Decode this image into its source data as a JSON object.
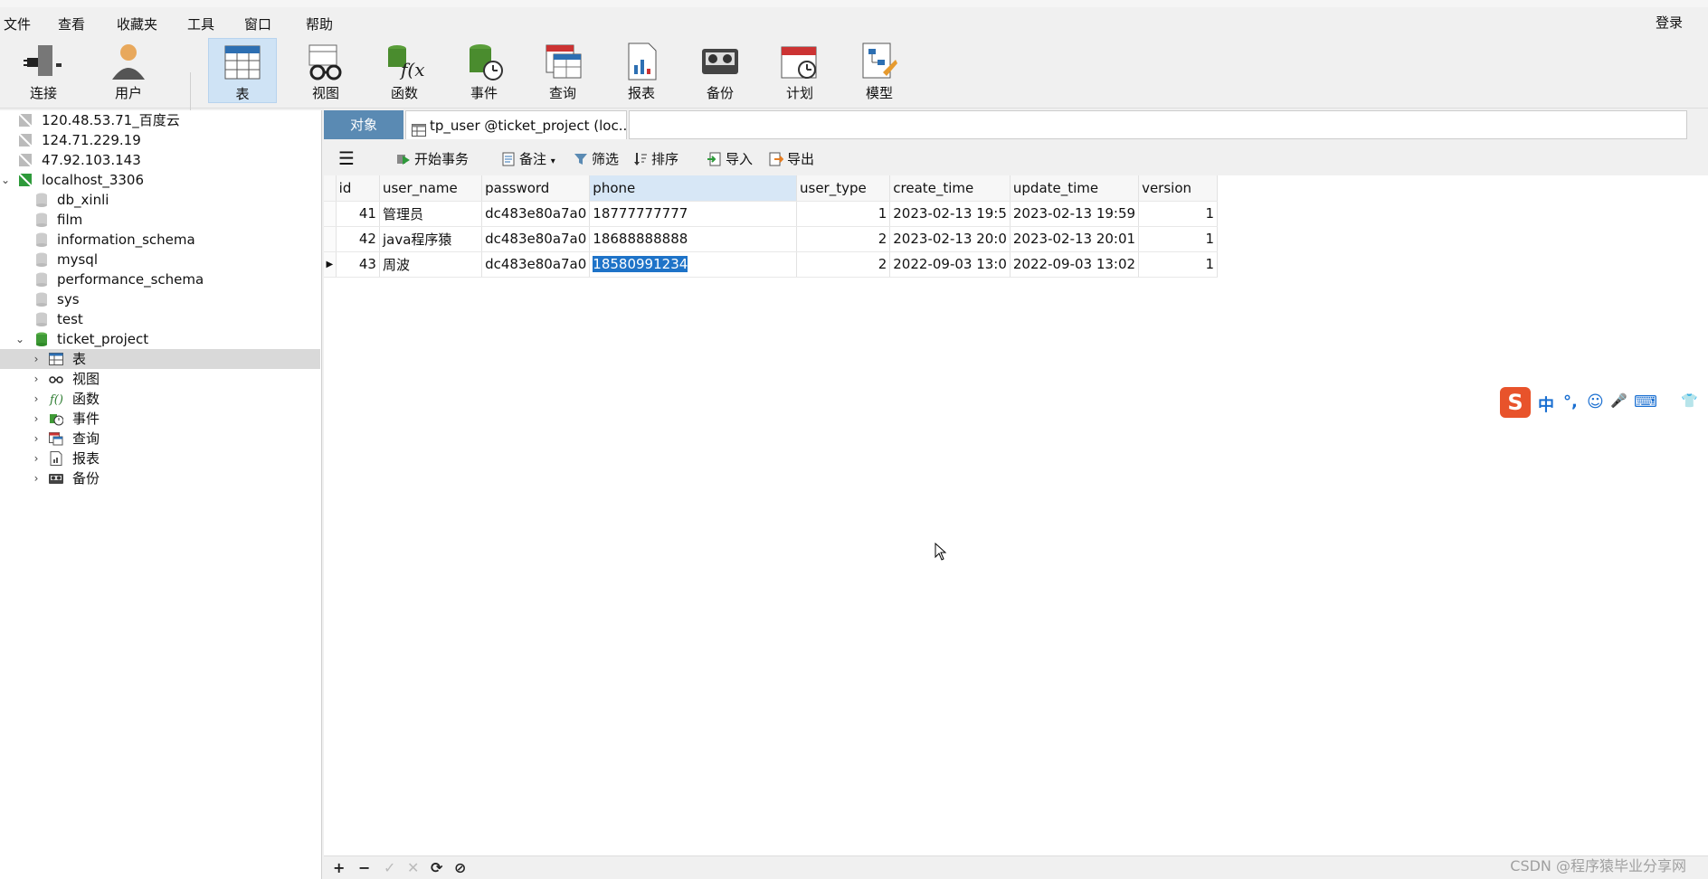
{
  "menu": [
    "文件",
    "查看",
    "收藏夹",
    "工具",
    "窗口",
    "帮助"
  ],
  "login_label": "登录",
  "toolbar": {
    "connect": "连接",
    "user": "用户",
    "table": "表",
    "view": "视图",
    "function": "函数",
    "event": "事件",
    "query": "查询",
    "report": "报表",
    "backup": "备份",
    "schedule": "计划",
    "model": "模型"
  },
  "sidebar": {
    "connections": [
      "120.48.53.71_百度云",
      "124.71.229.19",
      "47.92.103.143"
    ],
    "localhost": "localhost_3306",
    "databases": [
      "db_xinli",
      "film",
      "information_schema",
      "mysql",
      "performance_schema",
      "sys",
      "test"
    ],
    "ticket_project": "ticket_project",
    "children": [
      "表",
      "视图",
      "函数",
      "事件",
      "查询",
      "报表",
      "备份"
    ]
  },
  "tabs": {
    "objects": "对象",
    "doc": "tp_user @ticket_project (loc..."
  },
  "grid_toolbar": {
    "begin_tx": "开始事务",
    "note": "备注",
    "filter": "筛选",
    "sort": "排序",
    "import": "导入",
    "export": "导出"
  },
  "table": {
    "columns": [
      "id",
      "user_name",
      "password",
      "phone",
      "user_type",
      "create_time",
      "update_time",
      "version"
    ],
    "rows": [
      [
        "41",
        "管理员",
        "dc483e80a7a0",
        "18777777777",
        "1",
        "2023-02-13 19:5",
        "2023-02-13 19:59",
        "1"
      ],
      [
        "42",
        "java程序猿",
        "dc483e80a7a0",
        "18688888888",
        "2",
        "2023-02-13 20:0",
        "2023-02-13 20:01",
        "1"
      ],
      [
        "43",
        "周波",
        "dc483e80a7a0",
        "18580991234",
        "2",
        "2022-09-03 13:0",
        "2022-09-03 13:02",
        "1"
      ]
    ]
  },
  "ime": [
    "中",
    "°,",
    "☺",
    "🎤",
    "⌨",
    "👕"
  ],
  "watermark": "CSDN @程序猿毕业分享网",
  "colors": {
    "accent": "#5a8ab3",
    "selection": "#1e73c8",
    "ime": "#1a6fd1"
  }
}
